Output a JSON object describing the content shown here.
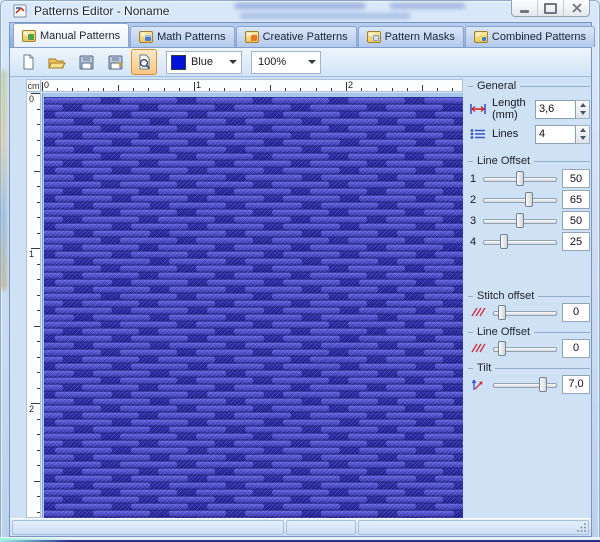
{
  "window": {
    "title": "Patterns Editor - Noname",
    "controls": [
      {
        "name": "minimize"
      },
      {
        "name": "maximize"
      },
      {
        "name": "close"
      }
    ]
  },
  "tabs": [
    {
      "label": "Manual Patterns",
      "icon": "manual-patterns-icon",
      "active": true
    },
    {
      "label": "Math Patterns",
      "icon": "math-patterns-icon",
      "active": false
    },
    {
      "label": "Creative Patterns",
      "icon": "creative-patterns-icon",
      "active": false
    },
    {
      "label": "Pattern Masks",
      "icon": "pattern-masks-icon",
      "active": false
    },
    {
      "label": "Combined Patterns",
      "icon": "combined-patterns-icon",
      "active": false
    }
  ],
  "toolbar": {
    "buttons": [
      {
        "name": "new",
        "icon": "new-document-icon"
      },
      {
        "name": "open",
        "icon": "open-folder-icon"
      },
      {
        "name": "save",
        "icon": "save-icon"
      },
      {
        "name": "save-as",
        "icon": "save-as-icon"
      },
      {
        "name": "preview",
        "icon": "page-magnifier-icon",
        "toggled": true
      }
    ],
    "color_select": {
      "value": "Blue",
      "swatch_color": "#0012d8"
    },
    "zoom_select": {
      "value": "100%"
    }
  },
  "ruler": {
    "unit": "cm",
    "h_labels": [
      "0",
      "1",
      "2"
    ],
    "v_labels": [
      "0",
      "1",
      "2"
    ]
  },
  "canvas": {
    "pattern_colors": {
      "float": "#5a5ad8",
      "background": "#232398",
      "shadow": "#1e1e8e"
    }
  },
  "panel": {
    "general": {
      "title": "General",
      "length": {
        "label": "Length (mm)",
        "value": "3,6",
        "icon": "length-icon"
      },
      "lines": {
        "label": "Lines",
        "value": "4",
        "icon": "lines-icon"
      }
    },
    "line_offset": {
      "title": "Line Offset",
      "rows": [
        {
          "label": "1",
          "value": "50",
          "pos": 50
        },
        {
          "label": "2",
          "value": "65",
          "pos": 63
        },
        {
          "label": "3",
          "value": "50",
          "pos": 50
        },
        {
          "label": "4",
          "value": "25",
          "pos": 25
        }
      ]
    },
    "stitch_offset": {
      "title": "Stitch offset",
      "value": "0",
      "pos": 9,
      "icon": "red-hatch-icon"
    },
    "line_offset_single": {
      "title": "Line Offset",
      "value": "0",
      "pos": 9,
      "icon": "red-hatch-icon"
    },
    "tilt": {
      "title": "Tilt",
      "value": "7,0",
      "pos": 82,
      "icon": "tilt-axis-icon"
    }
  },
  "statusbar": {
    "panels": [
      "",
      "",
      ""
    ]
  }
}
